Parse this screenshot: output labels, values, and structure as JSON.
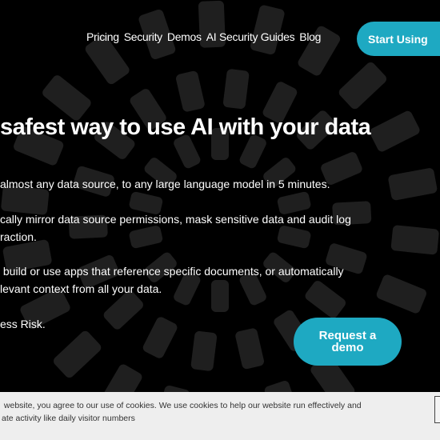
{
  "nav": {
    "items": [
      "Pricing",
      "Security",
      "Demos",
      "AI Security Guides",
      "Blog"
    ],
    "cta": "Start Using"
  },
  "hero": {
    "title": "safest way to use AI with your data",
    "paragraphs": [
      [
        "almost any data source, to any large language model in 5 minutes."
      ],
      [
        "cally mirror data source permissions, mask sensitive data and audit log",
        "raction."
      ],
      [
        " build or use apps that reference specific documents, or automatically",
        "levant context from all your data."
      ],
      [
        "ess Risk."
      ]
    ],
    "cta": "Request a demo"
  },
  "cookie": {
    "lines": [
      " website, you agree to our use of cookies. We use cookies to help our website run effectively and",
      "ate activity like daily visitor numbers"
    ]
  },
  "colors": {
    "accent": "#1ea9c2",
    "background": "#000000",
    "pattern": "#1f1f1f",
    "banner": "#eeeeee"
  }
}
